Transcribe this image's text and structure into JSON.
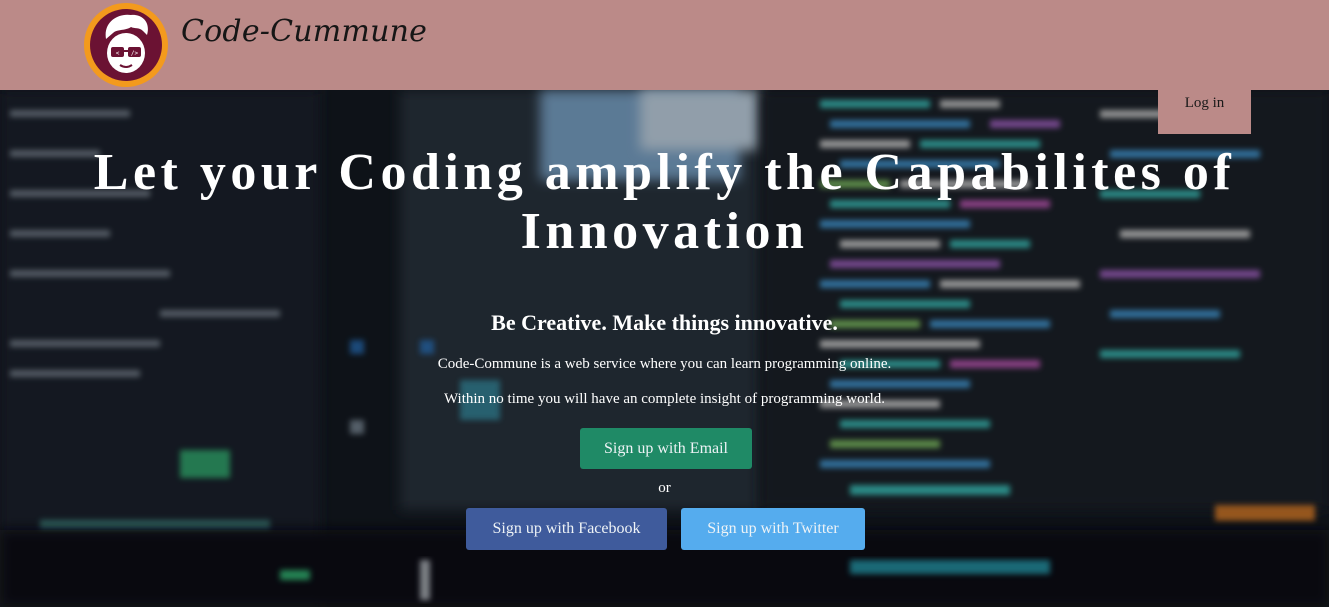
{
  "header": {
    "brand": "Code-Cummune",
    "login_label": "Log in"
  },
  "hero": {
    "title": "Let your Coding amplify the Capabilites of Innovation",
    "tagline": "Be Creative. Make things innovative.",
    "description_1": "Code-Commune is a web service where you can learn programming online.",
    "description_2": "Within no time you will have an complete insight of programming world.",
    "signup_email_label": "Sign up with Email",
    "or_text": "or",
    "signup_facebook_label": "Sign up with Facebook",
    "signup_twitter_label": "Sign up with Twitter"
  },
  "icons": {
    "logo": "coder-face-logo"
  },
  "colors": {
    "header_bg": "#bb8a88",
    "logo_ring": "#f39a1d",
    "logo_fill": "#6b1233",
    "email_button": "#1f8a66",
    "facebook_button": "#3f5b9c",
    "twitter_button": "#55acee"
  }
}
